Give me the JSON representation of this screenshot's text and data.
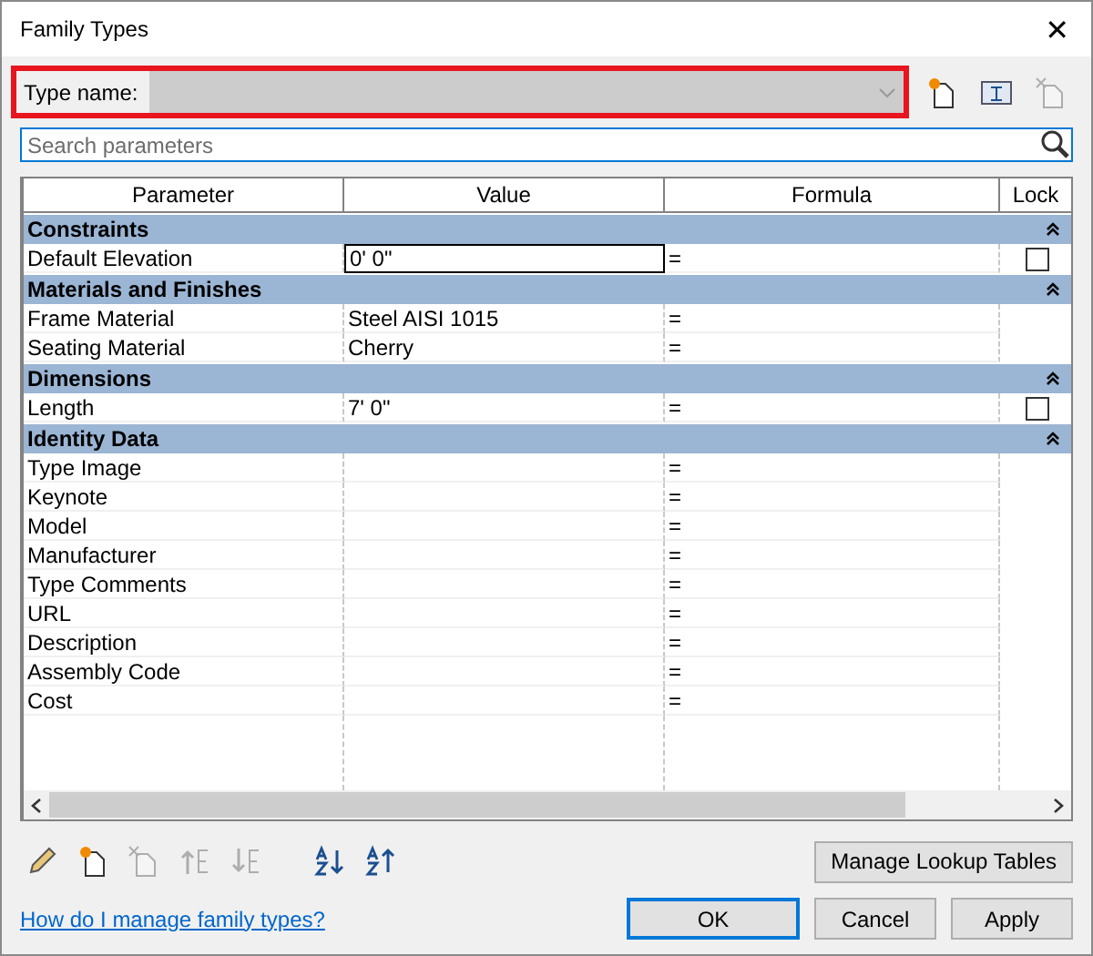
{
  "window": {
    "title": "Family Types",
    "close": "✕"
  },
  "type_name": {
    "label": "Type name:",
    "highlighted": true
  },
  "type_tools": [
    {
      "kind": "new",
      "disabled": false
    },
    {
      "kind": "rename",
      "disabled": false
    },
    {
      "kind": "delete",
      "disabled": true
    }
  ],
  "search": {
    "placeholder": "Search parameters"
  },
  "table": {
    "columns": [
      "Parameter",
      "Value",
      "Formula",
      "Lock"
    ],
    "rows": [
      {
        "kind": "group",
        "name": "Constraints",
        "expanded": true
      },
      {
        "kind": "param",
        "name": "Default Elevation",
        "value": "0'  0\"",
        "formula": "=",
        "selected": true,
        "locked": false
      },
      {
        "kind": "group",
        "name": "Materials and Finishes",
        "expanded": true
      },
      {
        "kind": "param",
        "name": "Frame Material",
        "value": "Steel AISI 1015",
        "formula": "=",
        "selected": false
      },
      {
        "kind": "param",
        "name": "Seating Material",
        "value": "Cherry",
        "formula": "=",
        "selected": false
      },
      {
        "kind": "group",
        "name": "Dimensions",
        "expanded": true
      },
      {
        "kind": "param",
        "name": "Length",
        "value": "7'  0\"",
        "formula": "=",
        "selected": false,
        "locked": false
      },
      {
        "kind": "group",
        "name": "Identity Data",
        "expanded": true
      },
      {
        "kind": "param",
        "name": "Type Image",
        "formula": "=",
        "selected": false
      },
      {
        "kind": "param",
        "name": "Keynote",
        "formula": "=",
        "selected": false
      },
      {
        "kind": "param",
        "name": "Model",
        "formula": "=",
        "selected": false
      },
      {
        "kind": "param",
        "name": "Manufacturer",
        "formula": "=",
        "selected": false
      },
      {
        "kind": "param",
        "name": "Type Comments",
        "formula": "=",
        "selected": false
      },
      {
        "kind": "param",
        "name": "URL",
        "formula": "=",
        "selected": false
      },
      {
        "kind": "param",
        "name": "Description",
        "formula": "=",
        "selected": false
      },
      {
        "kind": "param",
        "name": "Assembly Code",
        "formula": "=",
        "selected": false
      },
      {
        "kind": "param",
        "name": "Cost",
        "formula": "=",
        "selected": false
      }
    ]
  },
  "toolbar": [
    {
      "kind": "edit",
      "disabled": false
    },
    {
      "kind": "new",
      "disabled": false
    },
    {
      "kind": "delete",
      "disabled": true
    },
    {
      "kind": "up",
      "disabled": true
    },
    {
      "kind": "down",
      "disabled": true
    },
    {
      "kind": "sort_asc",
      "disabled": false
    },
    {
      "kind": "sort_desc",
      "disabled": false
    }
  ],
  "lookup_button": "Manage Lookup Tables",
  "help_link": "How do I manage family types?",
  "buttons": [
    {
      "label": "OK",
      "default": true
    },
    {
      "label": "Cancel",
      "default": false
    },
    {
      "label": "Apply",
      "default": false
    }
  ]
}
